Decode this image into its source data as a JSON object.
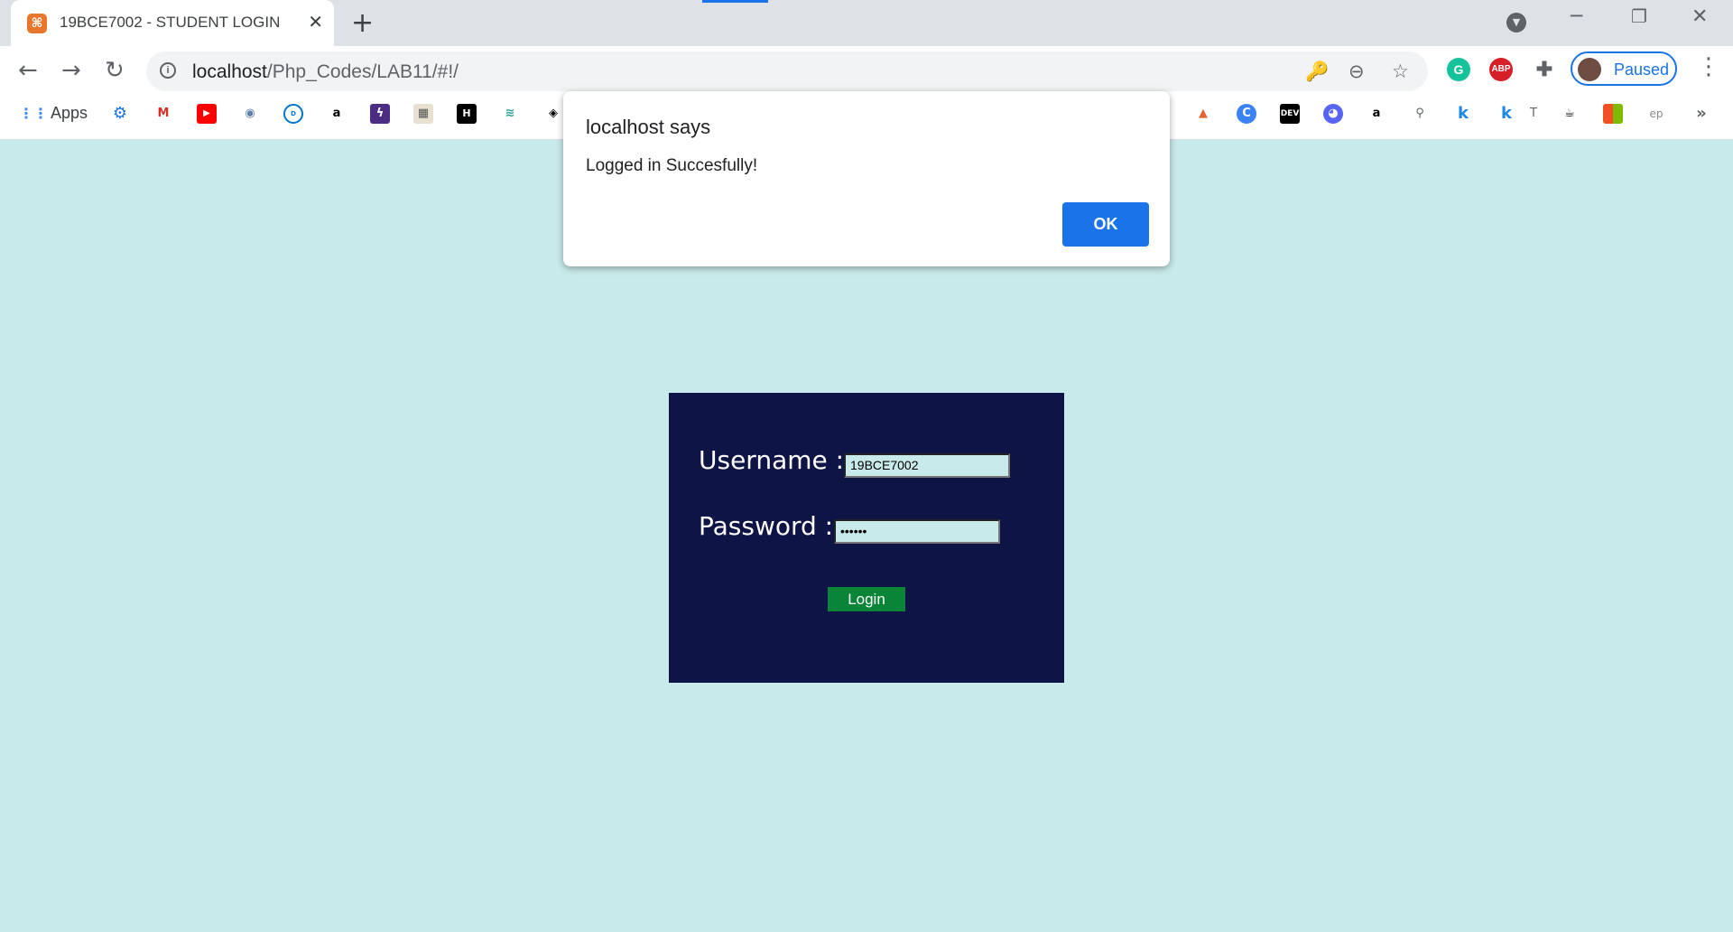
{
  "browser": {
    "tab_title": "19BCE7002 - STUDENT LOGIN",
    "tab_close": "✕",
    "new_tab": "+",
    "url_host": "localhost",
    "url_path": "/Php_Codes/LAB11/#!/",
    "profile_label": "Paused",
    "bookmarks_apps_label": "Apps",
    "bookmarks_more": "»"
  },
  "dialog": {
    "title": "localhost says",
    "message": "Logged in Succesfully!",
    "ok_label": "OK"
  },
  "login_form": {
    "username_label": "Username :",
    "username_value": "19BCE7002",
    "password_label": "Password :",
    "password_value": "••••••",
    "login_label": "Login"
  }
}
